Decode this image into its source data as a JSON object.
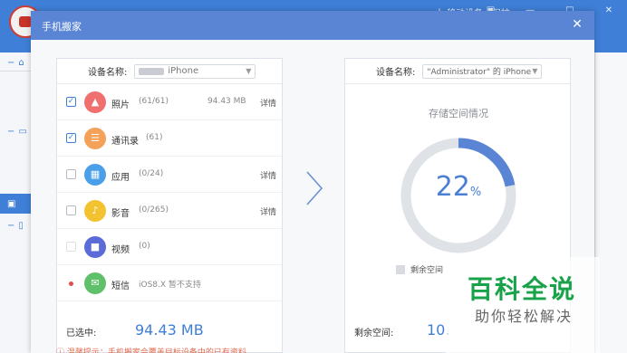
{
  "background": {
    "top_text": "人 移动设备 | 保护",
    "top_buttons": [
      "▣",
      "—",
      "□",
      "✕"
    ]
  },
  "dialog": {
    "title": "手机搬家",
    "close_label": "✕"
  },
  "source": {
    "device_label": "设备名称:",
    "device_value": "iPhone",
    "rows": [
      {
        "name": "照片",
        "count": "(61/61)",
        "size": "94.43 MB",
        "detail": "详情",
        "checked": true,
        "icon_color": "#f07070",
        "icon": "▲"
      },
      {
        "name": "通讯录",
        "count": "(61)",
        "size": "",
        "detail": "",
        "checked": true,
        "icon_color": "#f4a25a",
        "icon": "☰"
      },
      {
        "name": "应用",
        "count": "(0/24)",
        "size": "",
        "detail": "详情",
        "checked": false,
        "icon_color": "#4a9fe8",
        "icon": "▦"
      },
      {
        "name": "影音",
        "count": "(0/265)",
        "size": "",
        "detail": "详情",
        "checked": false,
        "icon_color": "#f2c230",
        "icon": "♪"
      },
      {
        "name": "视频",
        "count": "(0)",
        "size": "",
        "detail": "",
        "checked": false,
        "icon_color": "#5b6bd8",
        "icon": "■"
      },
      {
        "name": "短信",
        "count": "iOS8.X 暂不支持",
        "size": "",
        "detail": "",
        "checked": false,
        "icon_color": "#5fc06a",
        "icon": "✉"
      }
    ],
    "selected_label": "已选中:",
    "selected_value": "94.43 MB"
  },
  "target": {
    "device_label": "设备名称:",
    "device_value": "\"Administrator\" 的 iPhone",
    "storage_title": "存储空间情况",
    "percent": "22",
    "percent_unit": "%",
    "used_fraction": 0.22,
    "legend_label": "剩余空间",
    "remain_label": "剩余空间:",
    "remain_value": "10."
  },
  "tip": "ⓘ 温馨提示：手机搬家会覆盖目标设备中的已有资料",
  "watermark": {
    "main": "百科全说",
    "sub": "助你轻松解决"
  },
  "colors": {
    "accent": "#3f7fd7",
    "titlebar": "#5a85d5",
    "ring_used": "#5a85d5",
    "ring_free": "#dfe2e7"
  }
}
